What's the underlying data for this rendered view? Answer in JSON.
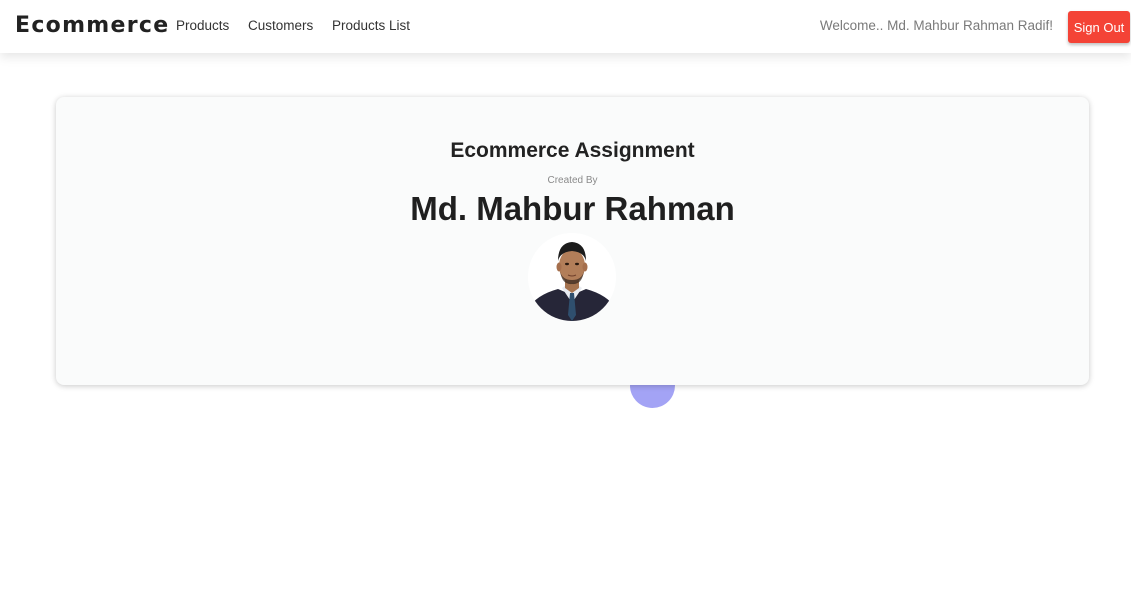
{
  "navbar": {
    "brand": "Ecommerce",
    "links": [
      "Products",
      "Customers",
      "Products List"
    ],
    "welcome": "Welcome.. Md. Mahbur Rahman Radif!",
    "signout_label": "Sign Out"
  },
  "card": {
    "title": "Ecommerce Assignment",
    "created_by": "Created By",
    "author": "Md. Mahbur Rahman"
  },
  "colors": {
    "signout": "#f44336",
    "blob": "#a3a3f5"
  }
}
